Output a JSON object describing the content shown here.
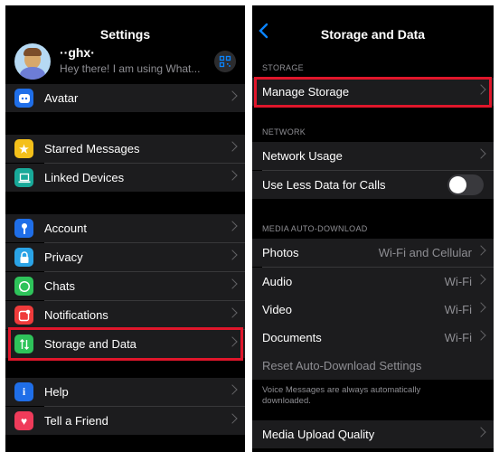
{
  "left": {
    "title": "Settings",
    "profile": {
      "name": "··ghx·",
      "status": "Hey there! I am using What..."
    },
    "groups": [
      [
        {
          "label": "Avatar",
          "color": "#1f6ee8",
          "icon": "avatar-icon"
        }
      ],
      [
        {
          "label": "Starred Messages",
          "color": "#f4c01a",
          "icon": "star-icon"
        },
        {
          "label": "Linked Devices",
          "color": "#18a999",
          "icon": "laptop-icon"
        }
      ],
      [
        {
          "label": "Account",
          "color": "#1f6ee8",
          "icon": "key-icon"
        },
        {
          "label": "Privacy",
          "color": "#2aa3e6",
          "icon": "lock-icon"
        },
        {
          "label": "Chats",
          "color": "#2ec35a",
          "icon": "whatsapp-icon"
        },
        {
          "label": "Notifications",
          "color": "#ef3b3b",
          "icon": "notification-icon"
        },
        {
          "label": "Storage and Data",
          "color": "#2ec35a",
          "icon": "storage-arrows-icon"
        }
      ],
      [
        {
          "label": "Help",
          "color": "#1f6ee8",
          "icon": "info-icon"
        },
        {
          "label": "Tell a Friend",
          "color": "#ef3b5a",
          "icon": "heart-icon"
        }
      ]
    ]
  },
  "right": {
    "title": "Storage and Data",
    "storage_header": "STORAGE",
    "manage_storage": "Manage Storage",
    "network_header": "NETWORK",
    "network_usage": "Network Usage",
    "less_data": "Use Less Data for Calls",
    "less_data_on": false,
    "media_header": "MEDIA AUTO-DOWNLOAD",
    "media": [
      {
        "label": "Photos",
        "value": "Wi-Fi and Cellular"
      },
      {
        "label": "Audio",
        "value": "Wi-Fi"
      },
      {
        "label": "Video",
        "value": "Wi-Fi"
      },
      {
        "label": "Documents",
        "value": "Wi-Fi"
      }
    ],
    "reset": "Reset Auto-Download Settings",
    "footnote": "Voice Messages are always automatically downloaded.",
    "upload_quality": "Media Upload Quality"
  },
  "colors": {
    "highlight": "#e0162b",
    "accent_blue": "#0a84ff"
  }
}
